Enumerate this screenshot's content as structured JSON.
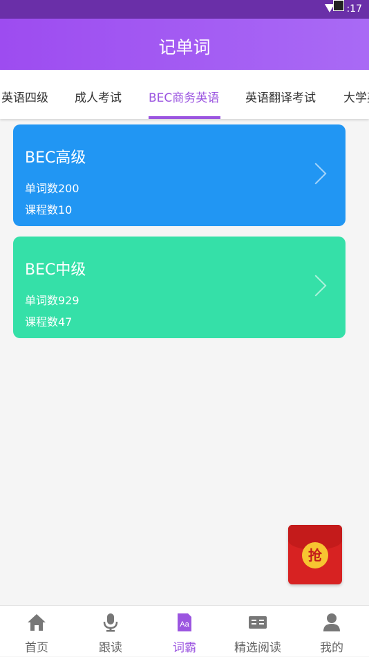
{
  "status_bar": {
    "time": ":17"
  },
  "app_bar": {
    "title": "记单词"
  },
  "tabs": [
    {
      "label": "英语四级"
    },
    {
      "label": "成人考试"
    },
    {
      "label": "BEC商务英语",
      "active": true
    },
    {
      "label": "英语翻译考试"
    },
    {
      "label": "大学英"
    }
  ],
  "cards": [
    {
      "title": "BEC高级",
      "words": "单词数200",
      "courses": "课程数10",
      "color": "#2196f3"
    },
    {
      "title": "BEC中级",
      "words": "单词数929",
      "courses": "课程数47",
      "color": "#35e0a8"
    }
  ],
  "red_packet": {
    "label": "抢"
  },
  "nav": {
    "items": [
      {
        "label": "首页",
        "icon": "home-icon"
      },
      {
        "label": "跟读",
        "icon": "microphone-icon"
      },
      {
        "label": "词霸",
        "icon": "dictionary-icon",
        "active": true
      },
      {
        "label": "精选阅读",
        "icon": "book-icon"
      },
      {
        "label": "我的",
        "icon": "user-icon"
      }
    ]
  },
  "colors": {
    "accent": "#9b55e0",
    "appbar_start": "#9d4cf0",
    "statusbar": "#6a2fa8"
  }
}
